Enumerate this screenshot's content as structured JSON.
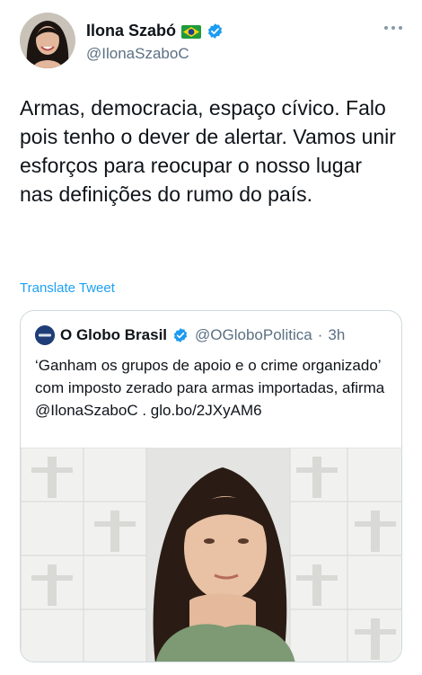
{
  "author": {
    "name": "Ilona Szabó",
    "handle": "@IlonaSzaboC",
    "flag_icon": "brazil-flag-icon",
    "verified_icon": "verified-badge-icon"
  },
  "tweet": {
    "text": "Armas, democracia, espaço cívico. Falo pois tenho o dever de alertar. Vamos unir esforços para reocupar o nosso lugar nas definições do rumo do país.",
    "translate_label": "Translate Tweet"
  },
  "quoted_tweet": {
    "name": "O Globo Brasil",
    "handle": "@OGloboPolitica",
    "separator": "·",
    "time": "3h",
    "text": "‘Ganham os grupos de apoio e o crime organizado’ com imposto zerado para armas importadas, afirma @IlonaSzaboC . glo.bo/2JXyAM6",
    "media_icon": "photo-of-woman"
  },
  "colors": {
    "accent": "#1da1f2",
    "secondary_text": "#5b7083",
    "border": "#cfd9de",
    "verified": "#1d9bf0"
  }
}
